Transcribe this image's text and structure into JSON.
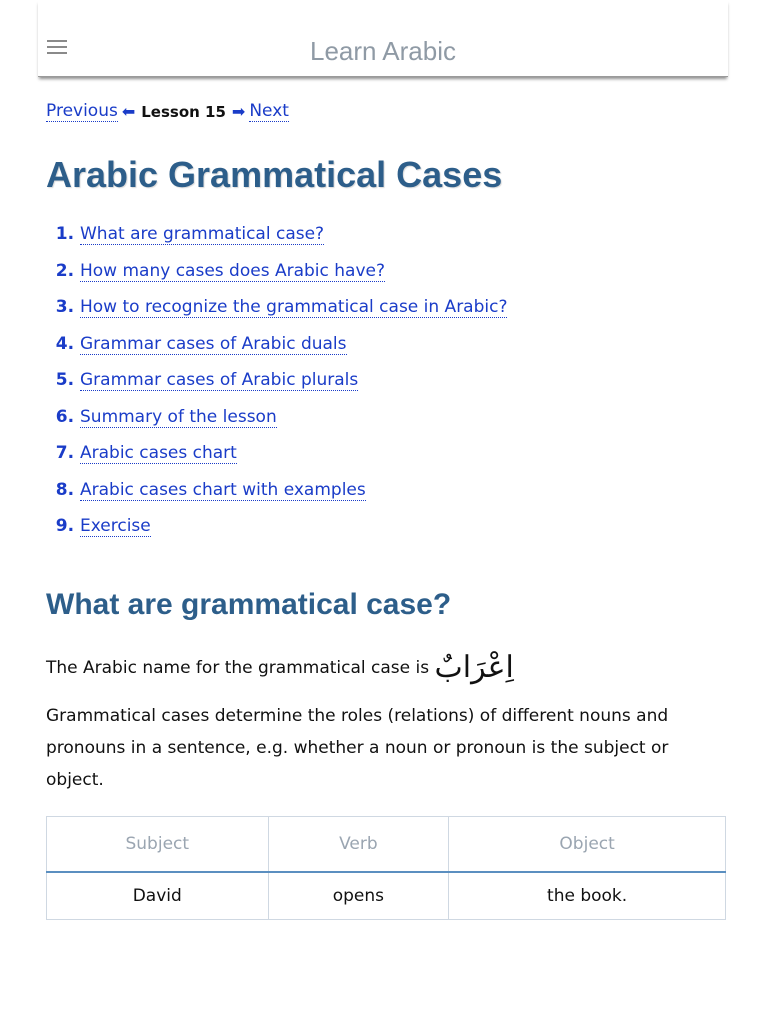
{
  "app": {
    "title": "Learn Arabic"
  },
  "nav": {
    "previous": "Previous",
    "lesson": "Lesson 15",
    "next": "Next"
  },
  "page_title": "Arabic Grammatical Cases",
  "toc": [
    {
      "num": "1.",
      "label": "What are grammatical case?"
    },
    {
      "num": "2.",
      "label": "How many cases does Arabic have?"
    },
    {
      "num": "3.",
      "label": "How to recognize the grammatical case in Arabic?"
    },
    {
      "num": "4.",
      "label": "Grammar cases of Arabic duals"
    },
    {
      "num": "5.",
      "label": "Grammar cases of Arabic plurals"
    },
    {
      "num": "6.",
      "label": "Summary of the lesson"
    },
    {
      "num": "7.",
      "label": "Arabic cases chart"
    },
    {
      "num": "8.",
      "label": "Arabic cases chart with examples"
    },
    {
      "num": "9.",
      "label": "Exercise"
    }
  ],
  "section": {
    "heading": "What are grammatical case?",
    "intro": "The Arabic name for the grammatical case is",
    "arabic_term": "اِعْرَابٌ",
    "paragraph": "Grammatical cases determine the roles (relations) of different nouns and pronouns in a sentence, e.g. whether a noun or pronoun is the subject or object."
  },
  "table": {
    "headers": [
      "Subject",
      "Verb",
      "Object"
    ],
    "rows": [
      [
        "David",
        "opens",
        "the book."
      ]
    ]
  },
  "colors": {
    "heading": "#2d5e8a",
    "link": "#1a3cc8",
    "table_accent": "#5b8fc0"
  },
  "icons": {
    "menu": "hamburger-menu-icon",
    "prev": "arrow-left-icon",
    "next": "arrow-right-icon"
  }
}
